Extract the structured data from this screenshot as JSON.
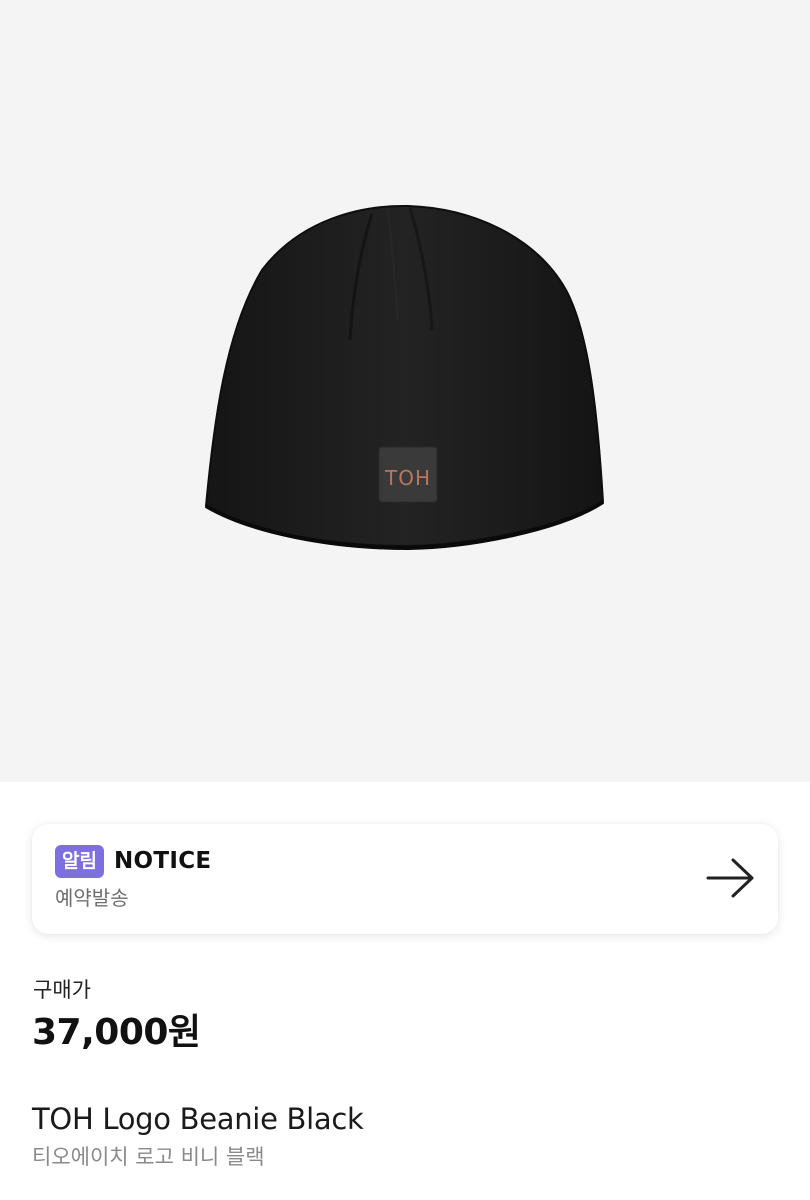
{
  "product": {
    "image_alt": "TOH Logo Beanie Black",
    "logo_patch_text": "TOH"
  },
  "notice": {
    "badge": "알림",
    "title": "NOTICE",
    "subtitle": "예약발송",
    "arrow_icon": "arrow-right-icon"
  },
  "price": {
    "label": "구매가",
    "value": "37,000원"
  },
  "name": {
    "english": "TOH Logo Beanie Black",
    "korean": "티오에이치 로고 비니 블랙"
  },
  "colors": {
    "image_bg": "#f4f4f4",
    "badge_bg": "#7d6fe0",
    "beanie": "#1c1c1c"
  }
}
